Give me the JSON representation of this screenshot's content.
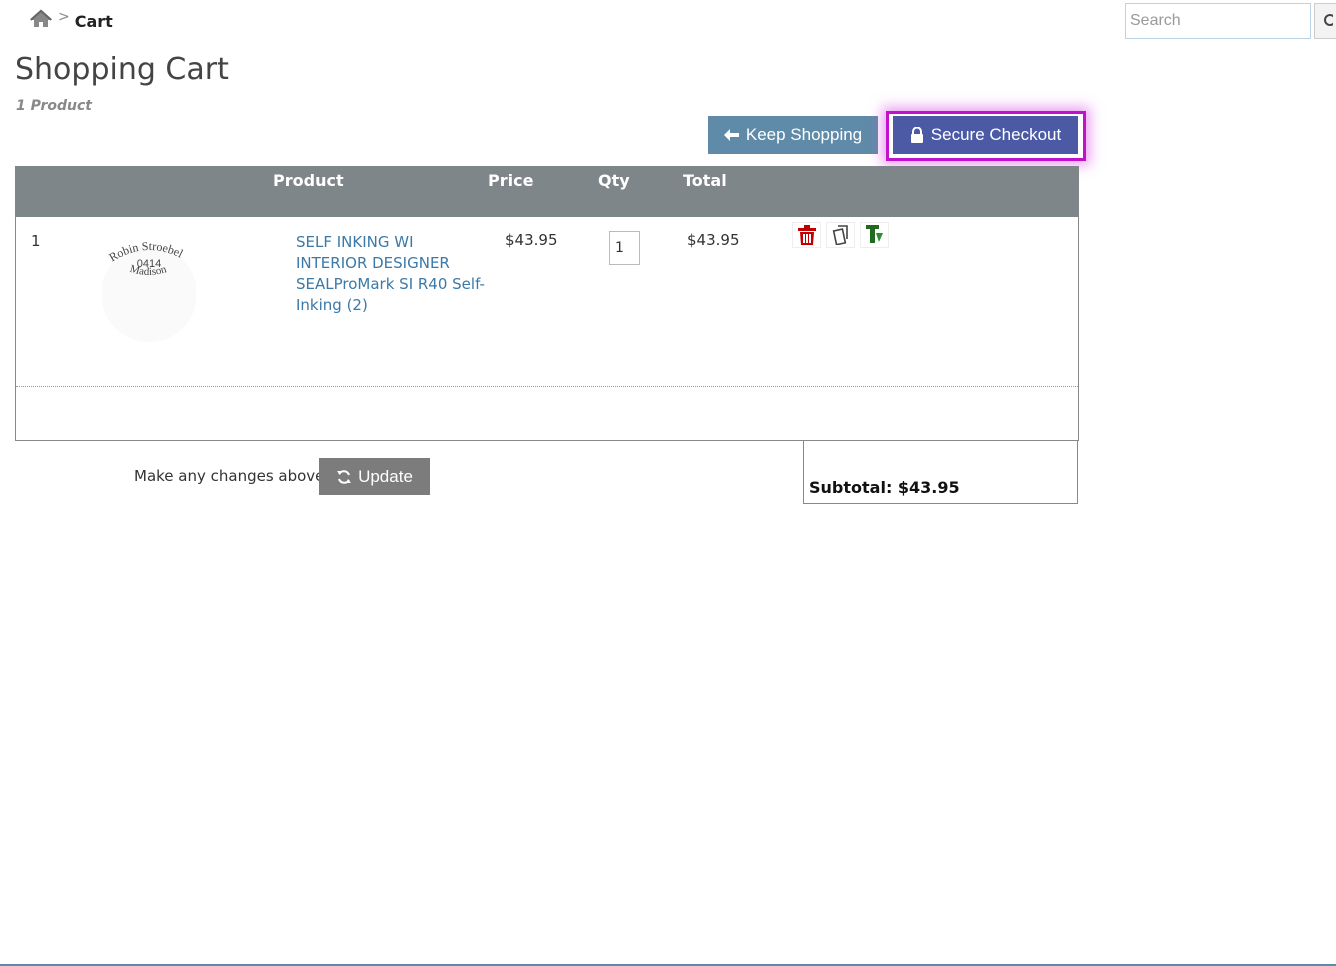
{
  "breadcrumb": {
    "separator": ">",
    "current": "Cart"
  },
  "search": {
    "placeholder": "Search",
    "value": ""
  },
  "page": {
    "title": "Shopping Cart",
    "product_count": "1 Product"
  },
  "buttons": {
    "keep_shopping": "Keep Shopping",
    "secure_checkout": "Secure Checkout",
    "update": "Update"
  },
  "table": {
    "headers": {
      "product": "Product",
      "price": "Price",
      "qty": "Qty",
      "total": "Total"
    },
    "rows": [
      {
        "index": "1",
        "image_text": [
          "Robin Stroebel",
          "0414",
          "Madison"
        ],
        "product_name": "SELF INKING WI INTERIOR DESIGNER SEALProMark SI R40 Self-Inking (2)",
        "price": "$43.95",
        "qty": "1",
        "total": "$43.95",
        "actions": [
          "trash-icon",
          "copy-icon",
          "tag-icon"
        ]
      }
    ]
  },
  "footer": {
    "changes_prompt": "Make any changes above?",
    "subtotal": "Subtotal: $43.95"
  },
  "colors": {
    "keep_shopping": "#5f8ba8",
    "checkout": "#4c5aa6",
    "highlight": "#c012c8",
    "header": "#7f8689",
    "link": "#3a79a8",
    "trash": "#c00000",
    "tag": "#1e6b1e"
  }
}
